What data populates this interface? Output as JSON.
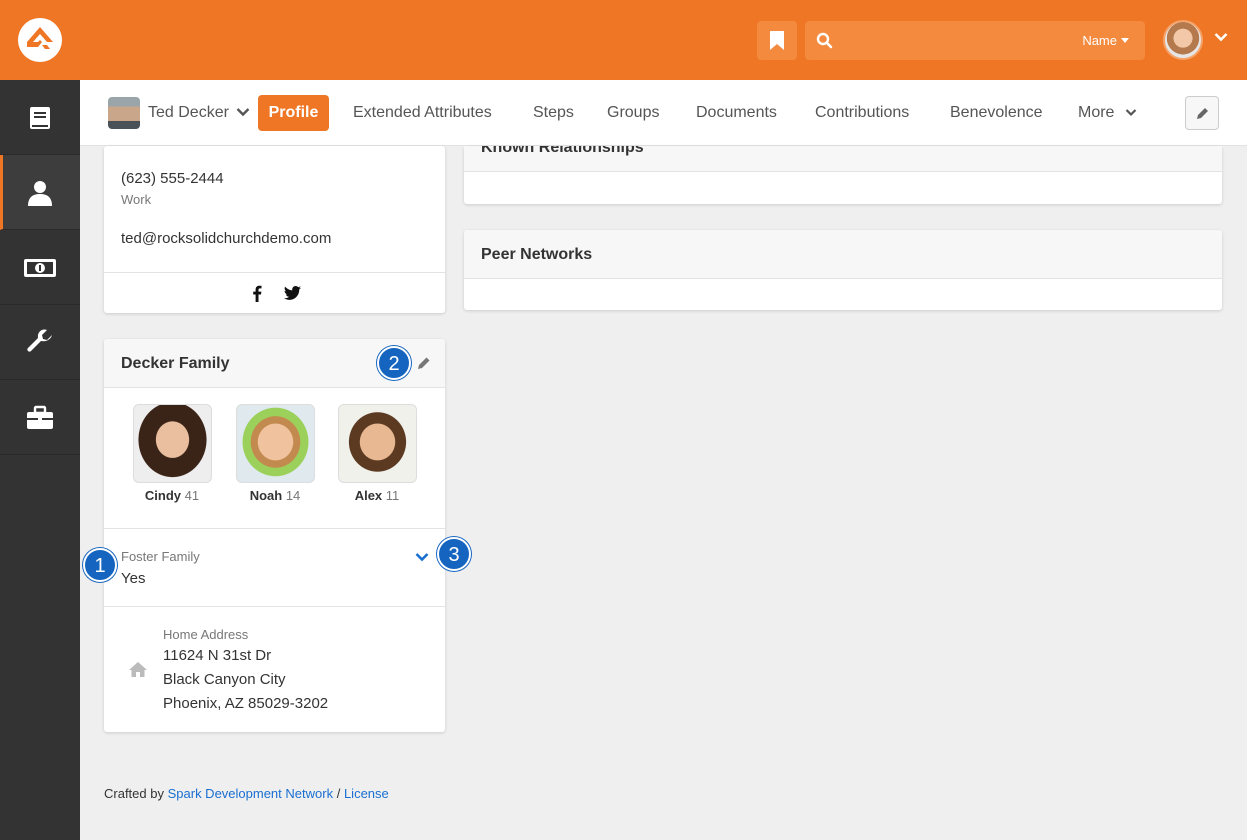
{
  "topbar": {
    "search": {
      "placeholder": "",
      "filter_label": "Name"
    }
  },
  "subnav": {
    "person_name": "Ted Decker",
    "active_tab": "Profile",
    "tabs": [
      "Extended Attributes",
      "Steps",
      "Groups",
      "Documents",
      "Contributions",
      "Benevolence",
      "More"
    ]
  },
  "contact": {
    "phone": "(623) 555-2444",
    "phone_type": "Work",
    "email": "ted@rocksolidchurchdemo.com"
  },
  "family": {
    "title": "Decker Family",
    "members": [
      {
        "name": "Cindy",
        "age": "41"
      },
      {
        "name": "Noah",
        "age": "14"
      },
      {
        "name": "Alex",
        "age": "11"
      }
    ],
    "attribute": {
      "label": "Foster Family",
      "value": "Yes"
    },
    "address": {
      "label": "Home Address",
      "line1": "11624 N 31st Dr",
      "line2": "Black Canyon City",
      "line3": "Phoenix, AZ 85029-3202"
    }
  },
  "panels": {
    "known_relationships": "Known Relationships",
    "peer_networks": "Peer Networks"
  },
  "badges": [
    "1",
    "2",
    "3"
  ],
  "footer": {
    "prefix": "Crafted by",
    "link1": "Spark Development Network",
    "separator": "/",
    "link2": "License"
  },
  "colors": {
    "brand": "#ee7625",
    "badge": "#1565c0",
    "sidebar": "#333333"
  }
}
